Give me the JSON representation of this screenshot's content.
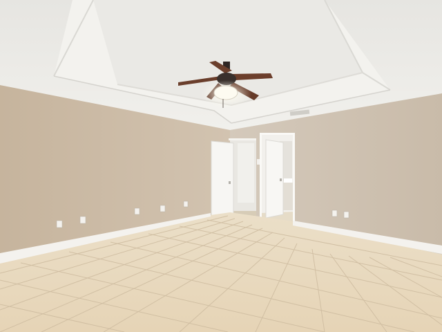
{
  "scene": {
    "subject": "empty-room-interior",
    "elements": [
      "tray-ceiling",
      "ceiling-fan",
      "left-wall",
      "right-wall",
      "doorways",
      "tile-floor",
      "baseboards",
      "outlets",
      "hvac-vent"
    ]
  },
  "colors": {
    "ceiling": "#ecebe7",
    "ceiling_tray": "#f3f2ee",
    "wall_left": "#c8b6a0",
    "wall_right": "#cfc3b4",
    "wall_center": "#d6ccbf",
    "floor": "#e8d9bf",
    "floor_grout": "#c9b79c",
    "baseboard": "#f4f2ee",
    "door": "#f6f5f2",
    "fan_blade": "#6b3f2c",
    "fan_metal": "#3a302c"
  }
}
